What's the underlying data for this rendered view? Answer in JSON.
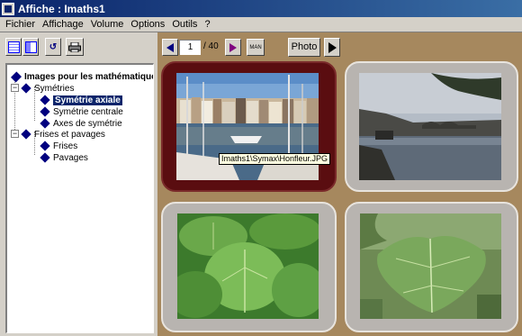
{
  "window": {
    "title": "Affiche : Imaths1"
  },
  "menu": [
    "Fichier",
    "Affichage",
    "Volume",
    "Options",
    "Outils",
    "?"
  ],
  "toolbar": {
    "rotate_label": "↺",
    "print_label": ""
  },
  "nav": {
    "page_value": "1",
    "page_total": "/ 40",
    "photo_label": "Photo",
    "mini_label": "MAN"
  },
  "tree": {
    "root": "Images pour les mathématiques",
    "items": [
      {
        "label": "Symétries"
      },
      {
        "label": "Symétrie axiale",
        "selected": true
      },
      {
        "label": "Symétrie centrale"
      },
      {
        "label": "Axes de symétrie"
      },
      {
        "label": "Frises et pavages"
      },
      {
        "label": "Frises"
      },
      {
        "label": "Pavages"
      }
    ]
  },
  "tooltip": "Imaths1\\Symax\\Honfleur.JPG",
  "photos": [
    {
      "name": "Honfleur harbor"
    },
    {
      "name": "River with bridge"
    },
    {
      "name": "Leaves close-up"
    },
    {
      "name": "Single leaf"
    }
  ],
  "colors": {
    "background": "#a6885e",
    "active_frame": "#5a0d10",
    "inactive_frame": "#b8b4b0",
    "title_bar": "#0a246a"
  }
}
